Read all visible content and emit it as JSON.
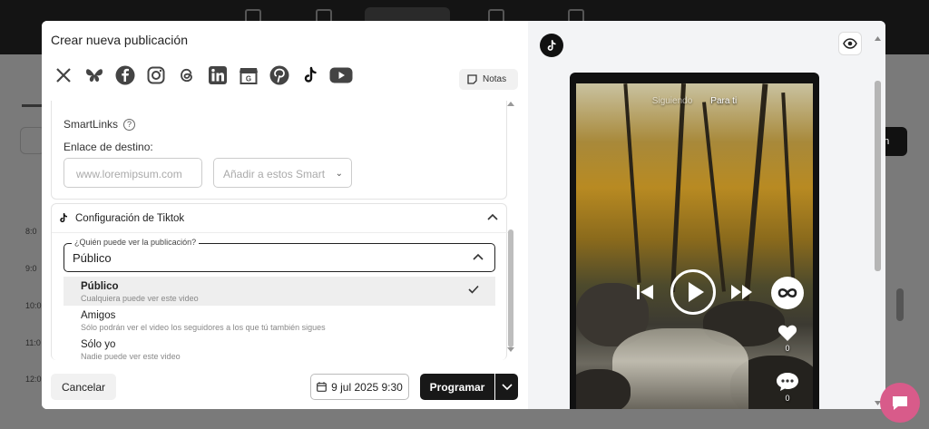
{
  "modal": {
    "title": "Crear nueva publicación",
    "notes_label": "Notas"
  },
  "socials": [
    {
      "icon": "x-icon",
      "glyph": "X"
    },
    {
      "icon": "bluesky-icon",
      "glyph": "🦋"
    },
    {
      "icon": "facebook-icon",
      "glyph": "f"
    },
    {
      "icon": "instagram-icon",
      "glyph": "◎"
    },
    {
      "icon": "threads-icon",
      "glyph": "@"
    },
    {
      "icon": "linkedin-icon",
      "glyph": "in"
    },
    {
      "icon": "google-business-icon",
      "glyph": "G"
    },
    {
      "icon": "pinterest-icon",
      "glyph": "P"
    },
    {
      "icon": "tiktok-icon",
      "glyph": "♪"
    },
    {
      "icon": "youtube-icon",
      "glyph": "▶"
    }
  ],
  "smartlinks": {
    "title": "SmartLinks",
    "help": "?",
    "dest_label": "Enlace de destino:",
    "url_placeholder": "www.loremipsum.com",
    "add_placeholder": "Añadir a estos Smart"
  },
  "tiktok_config": {
    "title": "Configuración de Tiktok",
    "who_label": "¿Quién puede ver la publicación?",
    "who_value": "Público",
    "options": [
      {
        "label": "Público",
        "desc": "Cualquiera puede ver este video",
        "selected": true
      },
      {
        "label": "Amigos",
        "desc": "Sólo podrán ver el video los seguidores a los que tú también sigues",
        "selected": false
      },
      {
        "label": "Sólo yo",
        "desc": "Nadie puede ver este video",
        "selected": false
      }
    ]
  },
  "footer": {
    "cancel_label": "Cancelar",
    "date_label": "9 jul 2025 9:30",
    "schedule_label": "Programar"
  },
  "preview": {
    "tab_following": "Siguiendo",
    "tab_foryou": "Para ti",
    "likes": "0",
    "comments": "0"
  },
  "background": {
    "times": [
      "8:0",
      "9:0",
      "10:0",
      "11:0",
      "12:0"
    ],
    "button_text": "ón"
  },
  "colors": {
    "dark": "#181818",
    "chat_bubble": "#d85b8a",
    "overlay": "#7a7a7a"
  }
}
